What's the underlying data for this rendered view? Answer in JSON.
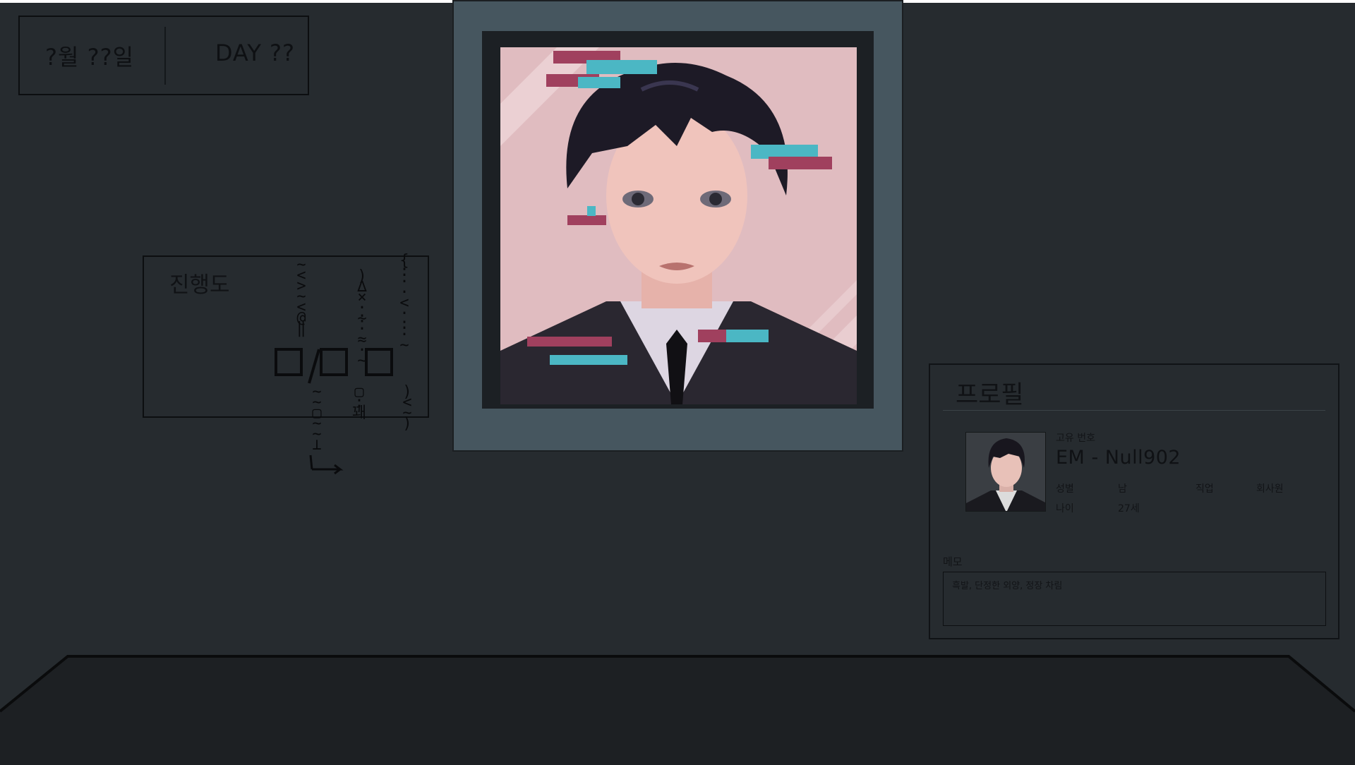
{
  "hud": {
    "date": "?월 ??일",
    "day": "DAY ??"
  },
  "progress": {
    "title": "진행도",
    "glitch_columns": [
      "~<>~<@",
      ")∆×·̶·↘·",
      "~:···<⁘·~",
      "▯∷⌡",
      "∃∷⌡⌥",
      "~~⌐~⌱→"
    ]
  },
  "profile": {
    "title": "프로필",
    "id_label": "고유 번호",
    "id_value": "EM - Null902",
    "gender_label": "성별",
    "gender_value": "남",
    "job_label": "직업",
    "job_value": "회사원",
    "age_label": "나이",
    "age_value": "27세",
    "memo_label": "메모",
    "memo_text": "흑발, 단정한 외양, 정장 차림"
  },
  "colors": {
    "background": "#262b2f",
    "floor": "#1d2023",
    "frame": "#46565f",
    "portrait_bg": "#e0bcc0",
    "glitch_cyan": "#4bb7c4",
    "glitch_magenta": "#a0405e"
  }
}
